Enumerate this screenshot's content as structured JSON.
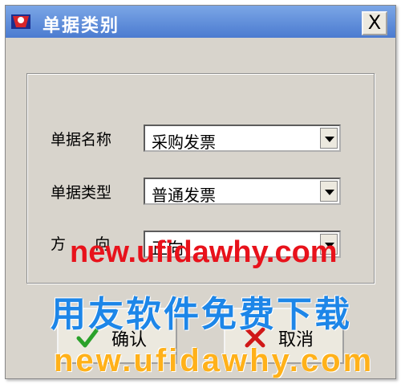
{
  "window": {
    "title": "单据类别",
    "close_glyph": "X"
  },
  "form": {
    "fields": [
      {
        "label": "单据名称",
        "value": "采购发票"
      },
      {
        "label": "单据类型",
        "value": "普通发票"
      },
      {
        "label": "方      向",
        "value": "正向"
      }
    ]
  },
  "buttons": {
    "confirm_label": "确认",
    "cancel_label": "取消"
  },
  "watermark": {
    "site_top": "new.ufidawhy.com",
    "banner": "用友软件免费下载",
    "site_bottom": "new.ufidawhy.com"
  },
  "colors": {
    "titlebar": "#5a8ad8",
    "dialog_bg": "#d8d4cc",
    "watermark_red": "#e8121b",
    "watermark_blue": "#1d86e8",
    "watermark_orange": "#ffb11a",
    "confirm_check": "#2aa12a",
    "cancel_x": "#d01818"
  },
  "icons": {
    "app": "app-logo-icon",
    "close": "close-icon",
    "dropdown": "chevron-down-icon",
    "confirm": "check-icon",
    "cancel": "x-mark-icon"
  }
}
